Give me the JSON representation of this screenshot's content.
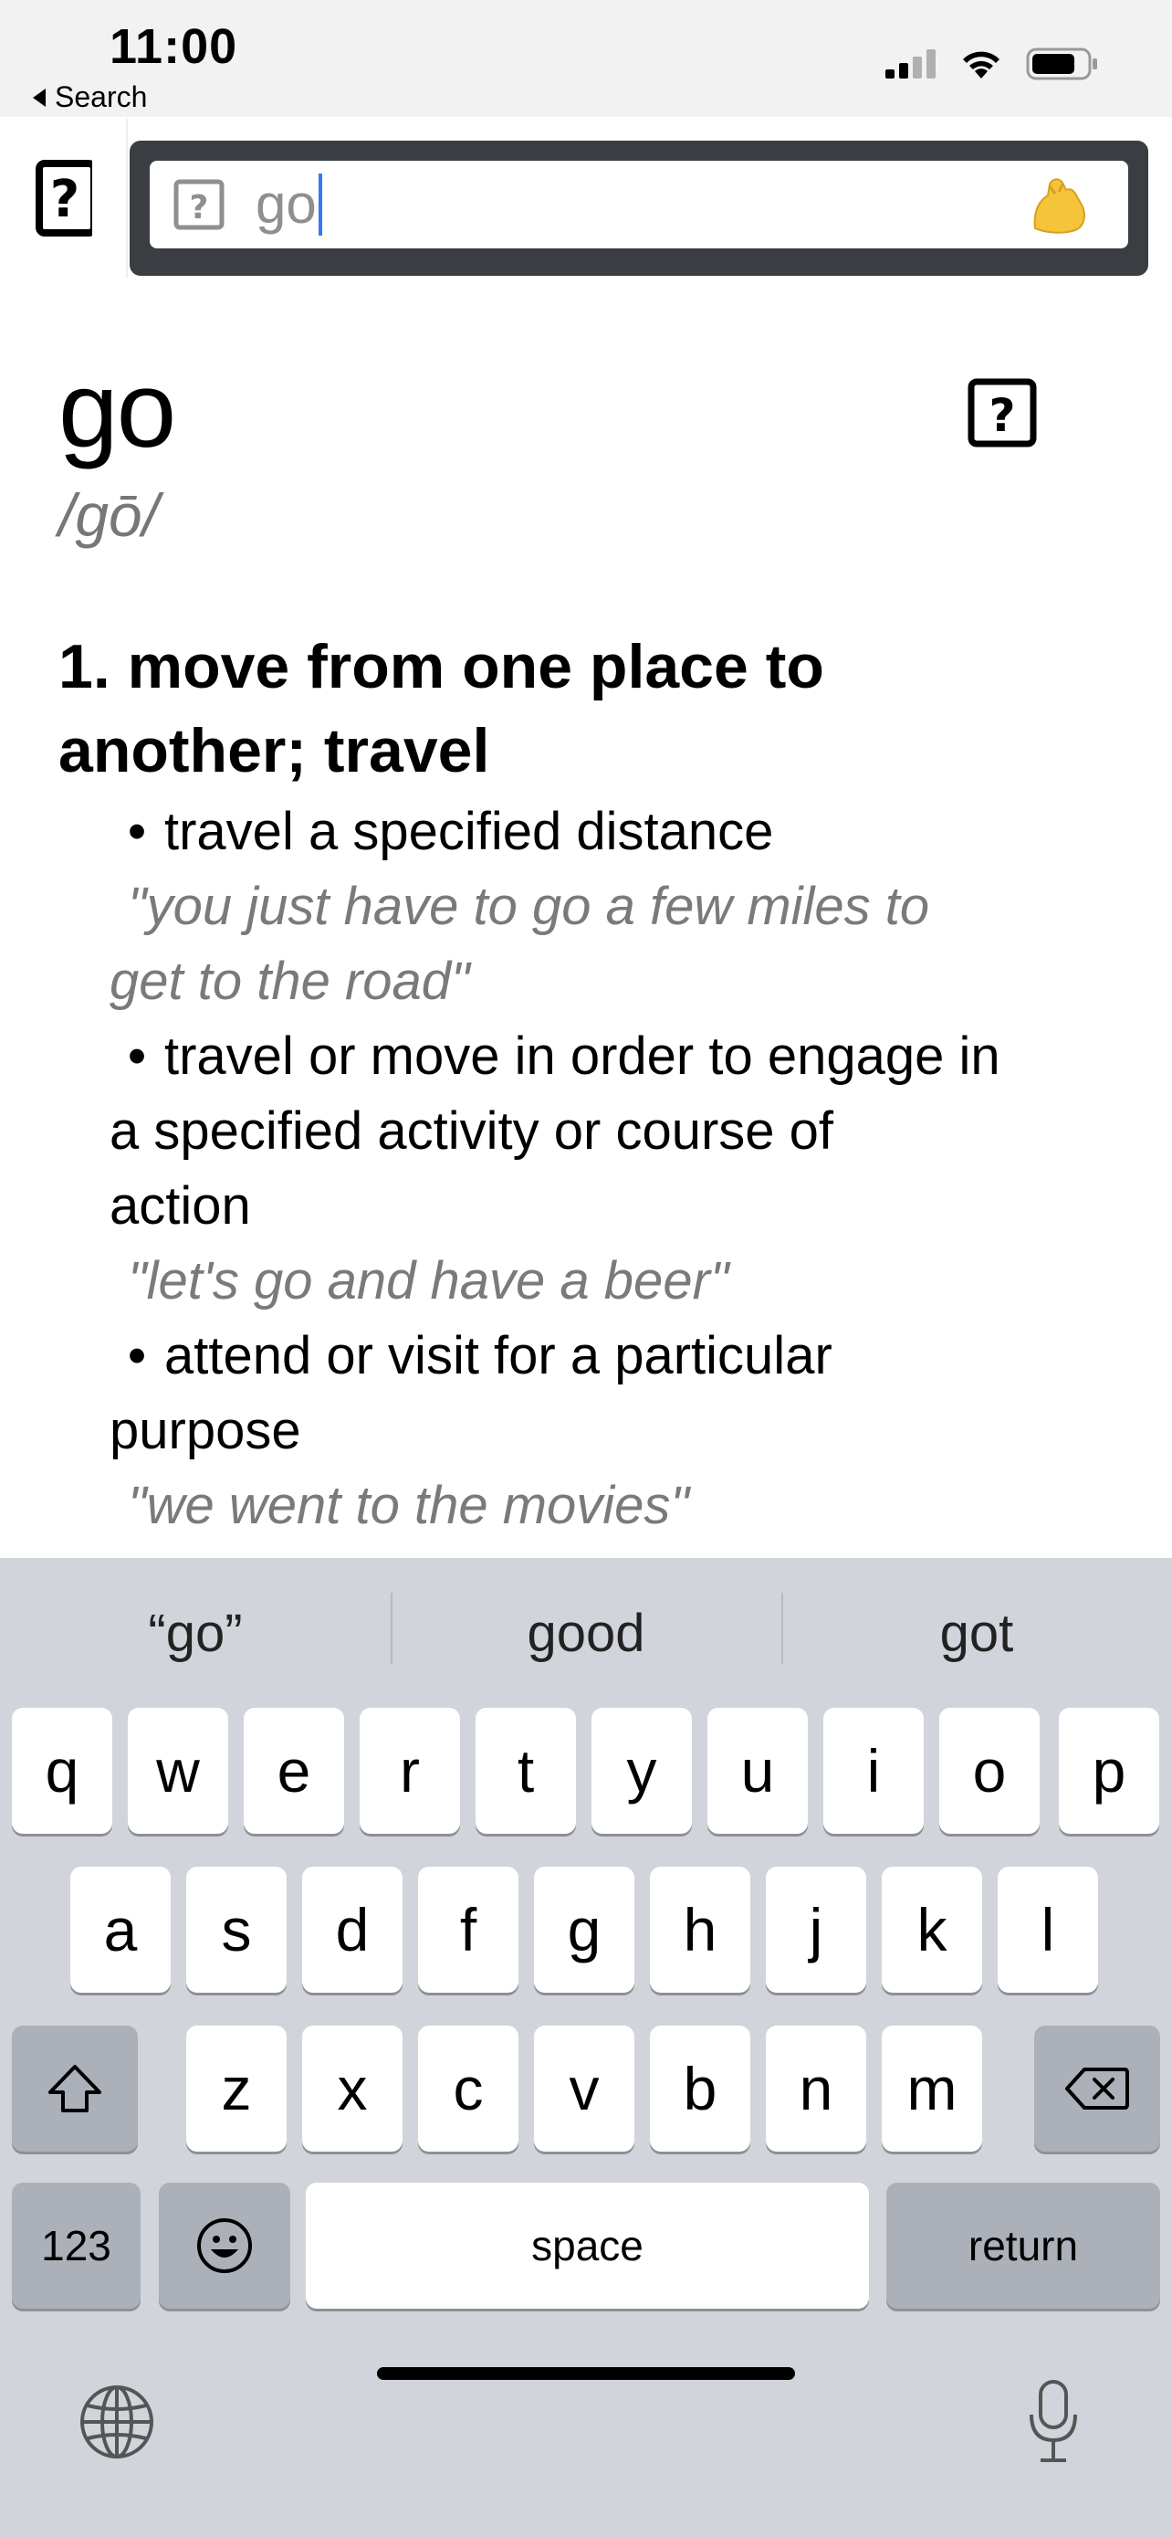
{
  "status_bar": {
    "time": "11:00",
    "back_label": "Search"
  },
  "search": {
    "query": "go"
  },
  "entry": {
    "word": "go",
    "pronunciation": "/gō/",
    "sense_title": "1. move from one place to another; travel",
    "sense_title_line1": "1. move from one place to",
    "sense_title_line2": "another; travel",
    "subsenses": [
      {
        "definition": "travel a specified distance",
        "example_line1": "\"you just have to go a few miles to",
        "example_line2": "get to the road\""
      },
      {
        "definition_line1": "travel or move in order to engage in",
        "definition_line2": "a specified activity or course of",
        "definition_line3": "action",
        "example": "\"let's go and have a beer\""
      },
      {
        "definition_line1": "attend or visit for a particular",
        "definition_line2": "purpose",
        "example": "\"we went to the movies\""
      }
    ]
  },
  "keyboard": {
    "suggestions": [
      "“go”",
      "good",
      "got"
    ],
    "row1": [
      "q",
      "w",
      "e",
      "r",
      "t",
      "y",
      "u",
      "i",
      "o",
      "p"
    ],
    "row2": [
      "a",
      "s",
      "d",
      "f",
      "g",
      "h",
      "j",
      "k",
      "l"
    ],
    "row3": [
      "z",
      "x",
      "c",
      "v",
      "b",
      "n",
      "m"
    ],
    "numbers_label": "123",
    "space_label": "space",
    "return_label": "return"
  },
  "icons": {
    "cellular": "signal-icon",
    "wifi": "wifi-icon",
    "battery": "battery-icon",
    "help": "question-box-icon",
    "flexed_biceps": "flexed-biceps-icon",
    "globe": "globe-icon",
    "microphone": "microphone-icon",
    "shift": "shift-icon",
    "delete": "delete-icon",
    "emoji": "emoji-icon"
  }
}
